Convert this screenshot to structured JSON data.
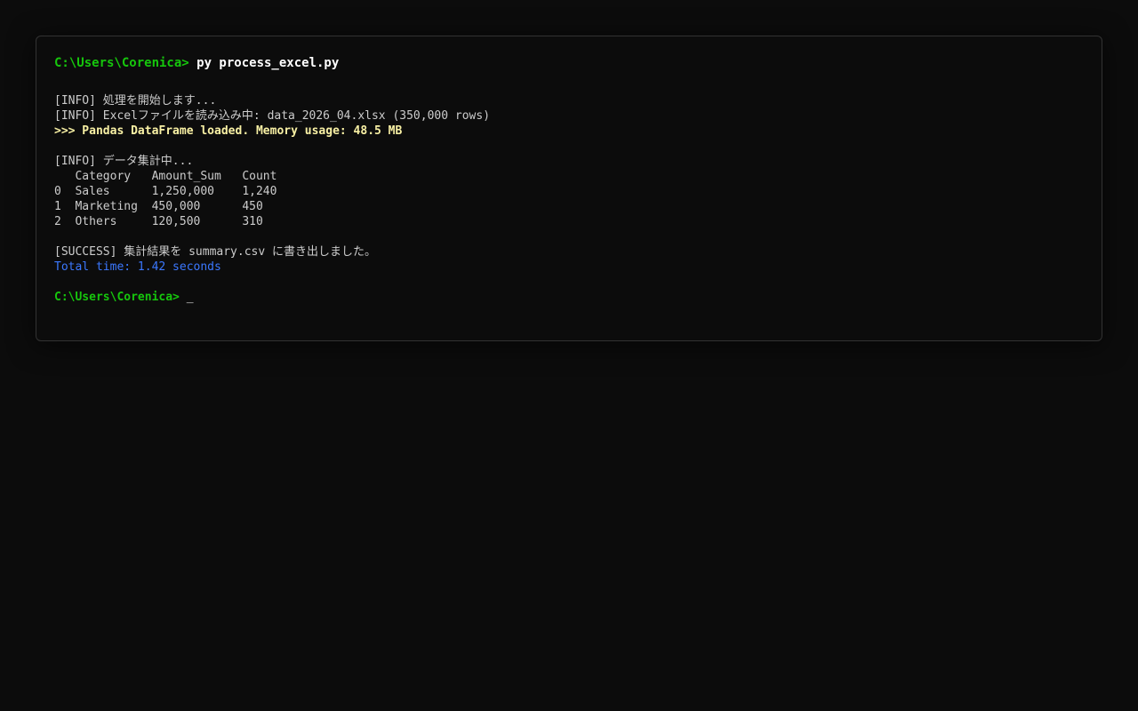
{
  "terminal": {
    "prompt": "C:\\Users\\Corenica>",
    "command": " py process_excel.py",
    "lines": [
      "[INFO] 処理を開始します...",
      "[INFO] Excelファイルを読み込み中: data_2026_04.xlsx (350,000 rows)",
      ">>> Pandas DataFrame loaded. Memory usage: 48.5 MB",
      "[INFO] データ集計中...",
      "   Category   Amount_Sum   Count",
      "0  Sales      1,250,000    1,240",
      "1  Marketing  450,000      450",
      "2  Others     120,500      310",
      "[SUCCESS] 集計結果を summary.csv に書き出しました。",
      "Total time: 1.42 seconds"
    ],
    "cursor": " _"
  },
  "colors": {
    "prompt": "#16c60c",
    "highlight": "#f9f1a5",
    "info_blue": "#3b78ff",
    "text": "#cccccc",
    "background": "#0c0c0c"
  }
}
